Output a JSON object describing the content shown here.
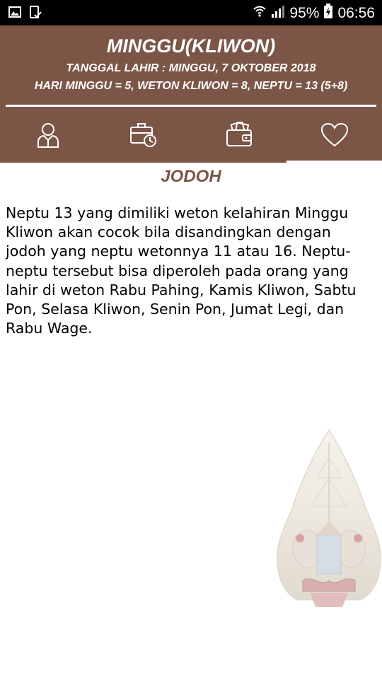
{
  "status_bar": {
    "battery": "95%",
    "time": "06:56"
  },
  "header": {
    "title": "MINGGU(KLIWON)",
    "birth_date_line": "TANGGAL LAHIR : MINGGU, 7 OKTOBER 2018",
    "neptu_line": "HARI MINGGU = 5, WETON KLIWON = 8, NEPTU = 13 (5+8)"
  },
  "tabs": [
    {
      "icon": "person-icon"
    },
    {
      "icon": "briefcase-clock-icon"
    },
    {
      "icon": "wallet-icon"
    },
    {
      "icon": "heart-icon",
      "selected": true
    }
  ],
  "content": {
    "section_title": "JODOH",
    "paragraph": "Neptu 13 yang dimiliki weton kelahiran Minggu Kliwon akan cocok bila disandingkan dengan jodoh yang neptu wetonnya 11 atau 16. Neptu-neptu tersebut bisa diperoleh pada orang yang lahir di weton Rabu Pahing, Kamis Kliwon, Sabtu Pon, Selasa Kliwon, Senin Pon, Jumat Legi, dan Rabu Wage."
  },
  "colors": {
    "header_bg": "#7b5647",
    "accent": "#7b5647",
    "status_bg": "#000000"
  },
  "decoration": {
    "icon": "gunungan-wayang-icon"
  }
}
